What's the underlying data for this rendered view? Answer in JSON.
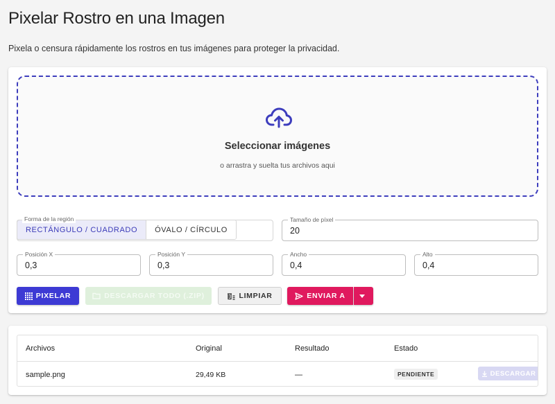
{
  "header": {
    "title": "Pixelar Rostro en una Imagen",
    "subtitle": "Pixela o censura rápidamente los rostros en tus imágenes para proteger la privacidad."
  },
  "dropzone": {
    "title": "Seleccionar imágenes",
    "subtitle": "o arrastra y suelta tus archivos aqui",
    "icon": "cloud-upload-icon"
  },
  "form": {
    "shape": {
      "label": "Forma de la región",
      "options": [
        "RECTÁNGULO / CUADRADO",
        "ÓVALO / CÍRCULO"
      ],
      "selected": "RECTÁNGULO / CUADRADO"
    },
    "pixel_size": {
      "label": "Tamaño de píxel",
      "value": "20"
    },
    "pos_x": {
      "label": "Posición X",
      "value": "0,3"
    },
    "pos_y": {
      "label": "Posición Y",
      "value": "0,3"
    },
    "ancho": {
      "label": "Ancho",
      "value": "0,4"
    },
    "alto": {
      "label": "Alto",
      "value": "0,4"
    }
  },
  "actions": {
    "pixelar": "PIXELAR",
    "descargar_todo": "DESCARGAR TODO (.ZIP)",
    "limpiar": "LIMPIAR",
    "enviar": "ENVIAR A"
  },
  "files_table": {
    "columns": [
      "Archivos",
      "Original",
      "Resultado",
      "Estado"
    ],
    "rows": [
      {
        "archivo": "sample.png",
        "original": "29,49 KB",
        "resultado": "—",
        "estado": "PENDIENTE",
        "download_label": "DESCARGAR"
      }
    ]
  },
  "colors": {
    "primary": "#3d3ad4",
    "accent": "#e0195e",
    "dropzone_border": "#3d3dbd",
    "success_disabled": "#dff0dc"
  }
}
